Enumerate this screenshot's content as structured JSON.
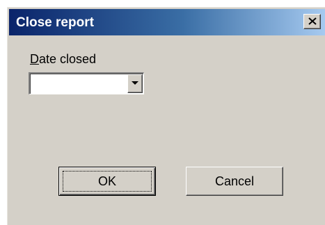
{
  "window": {
    "title": "Close report",
    "close_icon": "close-x-icon"
  },
  "form": {
    "date_label_mnemonic": "D",
    "date_label_rest": "ate closed",
    "date_value": "",
    "dropdown_icon": "chevron-down-icon"
  },
  "buttons": {
    "ok_label": "OK",
    "cancel_label": "Cancel"
  },
  "colors": {
    "face": "#d4d0c8",
    "title_start": "#0a246a",
    "title_end": "#a6caf0"
  }
}
